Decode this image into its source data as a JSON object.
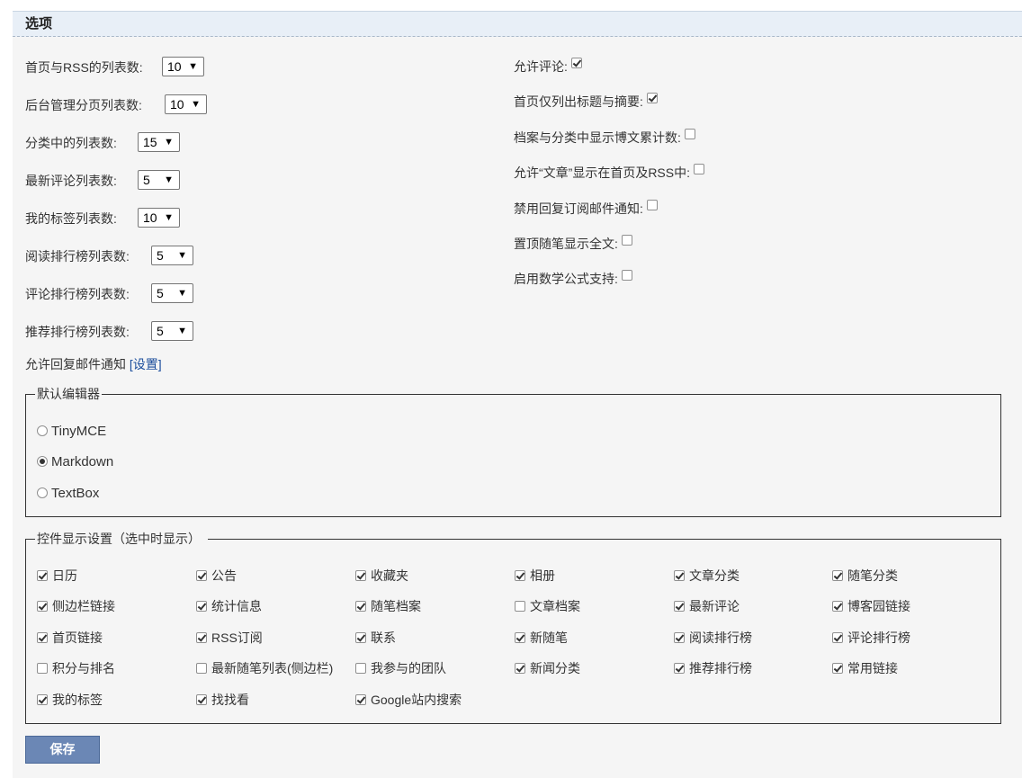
{
  "panel": {
    "title": "选项"
  },
  "left_settings": [
    {
      "label": "首页与RSS的列表数:",
      "value": "10"
    },
    {
      "label": "后台管理分页列表数:",
      "value": "10"
    },
    {
      "label": "分类中的列表数:",
      "value": "15"
    },
    {
      "label": "最新评论列表数:",
      "value": "5"
    },
    {
      "label": "我的标签列表数:",
      "value": "10"
    },
    {
      "label": "阅读排行榜列表数:",
      "value": "5"
    },
    {
      "label": "评论排行榜列表数:",
      "value": "5"
    },
    {
      "label": "推荐排行榜列表数:",
      "value": "5"
    }
  ],
  "reply_notify": {
    "label": "允许回复邮件通知",
    "link": "[设置]"
  },
  "right_settings": [
    {
      "label": "允许评论:",
      "checked": true
    },
    {
      "label": "首页仅列出标题与摘要:",
      "checked": true
    },
    {
      "label": "档案与分类中显示博文累计数:",
      "checked": false
    },
    {
      "label": "允许“文章”显示在首页及RSS中:",
      "checked": false
    },
    {
      "label": "禁用回复订阅邮件通知:",
      "checked": false
    },
    {
      "label": "置顶随笔显示全文:",
      "checked": false
    },
    {
      "label": "启用数学公式支持:",
      "checked": false
    }
  ],
  "editor": {
    "legend": "默认编辑器",
    "options": [
      {
        "label": "TinyMCE",
        "selected": false
      },
      {
        "label": "Markdown",
        "selected": true
      },
      {
        "label": "TextBox",
        "selected": false
      }
    ]
  },
  "widgets": {
    "legend": "控件显示设置（选中时显示）",
    "items": [
      {
        "label": "日历",
        "checked": true
      },
      {
        "label": "公告",
        "checked": true
      },
      {
        "label": "收藏夹",
        "checked": true
      },
      {
        "label": "相册",
        "checked": true
      },
      {
        "label": "文章分类",
        "checked": true
      },
      {
        "label": "随笔分类",
        "checked": true
      },
      {
        "label": "侧边栏链接",
        "checked": true
      },
      {
        "label": "统计信息",
        "checked": true
      },
      {
        "label": "随笔档案",
        "checked": true
      },
      {
        "label": "文章档案",
        "checked": false
      },
      {
        "label": "最新评论",
        "checked": true
      },
      {
        "label": "博客园链接",
        "checked": true
      },
      {
        "label": "首页链接",
        "checked": true
      },
      {
        "label": "RSS订阅",
        "checked": true
      },
      {
        "label": "联系",
        "checked": true
      },
      {
        "label": "新随笔",
        "checked": true
      },
      {
        "label": "阅读排行榜",
        "checked": true
      },
      {
        "label": "评论排行榜",
        "checked": true
      },
      {
        "label": "积分与排名",
        "checked": false
      },
      {
        "label": "最新随笔列表(侧边栏)",
        "checked": false
      },
      {
        "label": "我参与的团队",
        "checked": false
      },
      {
        "label": "新闻分类",
        "checked": true
      },
      {
        "label": "推荐排行榜",
        "checked": true
      },
      {
        "label": "常用链接",
        "checked": true
      },
      {
        "label": "我的标签",
        "checked": true
      },
      {
        "label": "找找看",
        "checked": true
      },
      {
        "label": "Google站内搜索",
        "checked": true
      }
    ]
  },
  "save_button": {
    "label": "保存"
  },
  "icons": {
    "dropdown": "triangle-down-icon"
  }
}
